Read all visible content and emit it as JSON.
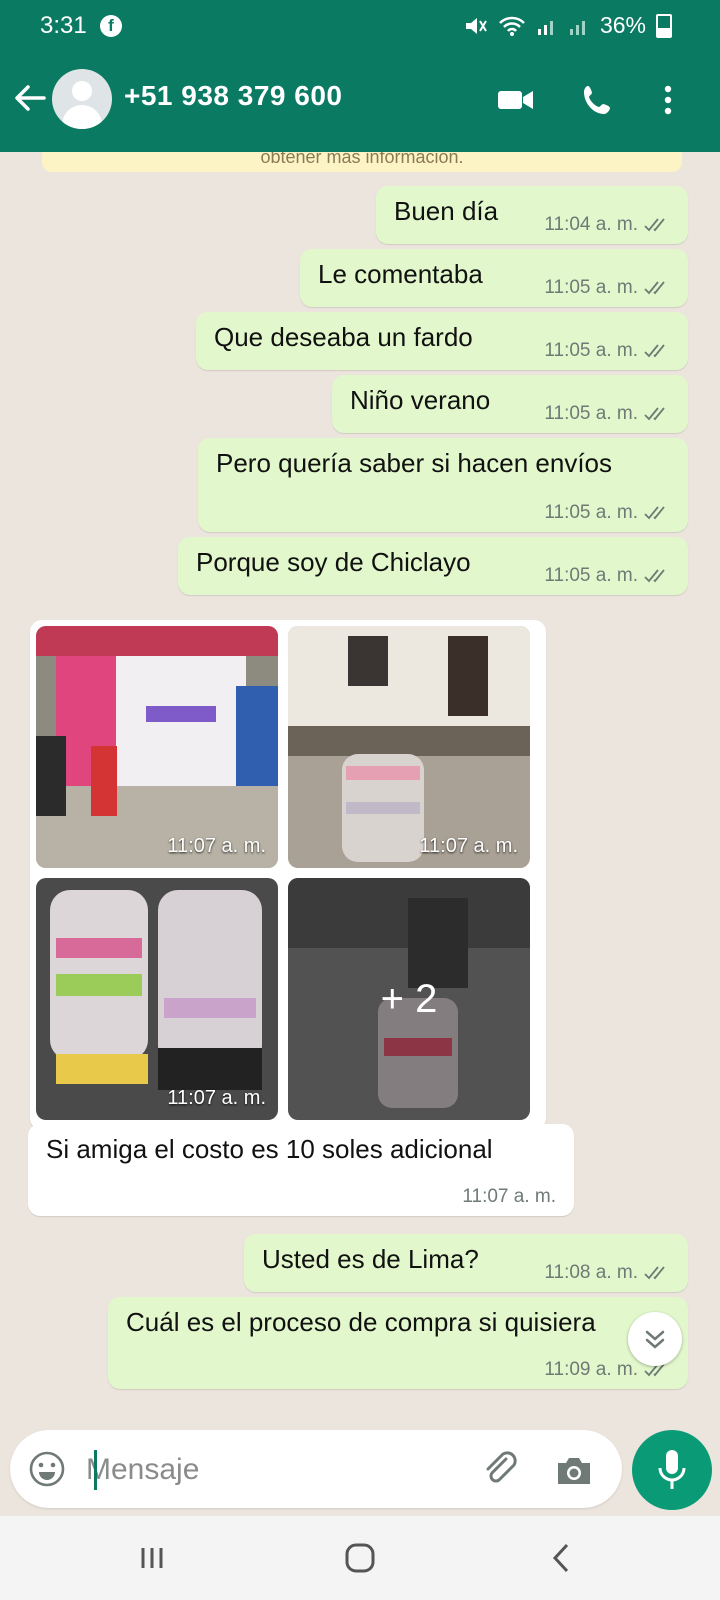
{
  "status_bar": {
    "time": "3:31",
    "battery": "36%"
  },
  "header": {
    "contact": "+51 938 379 600"
  },
  "banner": {
    "text": "obtener más información."
  },
  "messages": [
    {
      "text": "Buen día",
      "time": "11:04 a. m."
    },
    {
      "text": "Le comentaba",
      "time": "11:05 a. m."
    },
    {
      "text": "Que deseaba un fardo",
      "time": "11:05 a. m."
    },
    {
      "text": "Niño verano",
      "time": "11:05 a. m."
    },
    {
      "text": "Pero quería saber si hacen envíos",
      "time": "11:05 a. m."
    },
    {
      "text": "Porque soy de Chiclayo",
      "time": "11:05 a. m."
    },
    {
      "text": "Si amiga el costo es 10 soles adicional",
      "time": "11:07 a. m."
    },
    {
      "text": "Usted es de Lima?",
      "time": "11:08 a. m."
    },
    {
      "text": "Cuál es el proceso de compra si quisiera",
      "time": "11:09 a. m."
    }
  ],
  "photos": [
    {
      "time": "11:07 a. m."
    },
    {
      "time": "11:07 a. m."
    },
    {
      "time": "11:07 a. m."
    },
    {
      "more": "+ 2"
    }
  ],
  "composer": {
    "placeholder": "Mensaje"
  },
  "colors": {
    "header": "#0a7a63",
    "outgoing": "#e2f8cc",
    "incoming": "#ffffff",
    "accent": "#0a9b76"
  }
}
